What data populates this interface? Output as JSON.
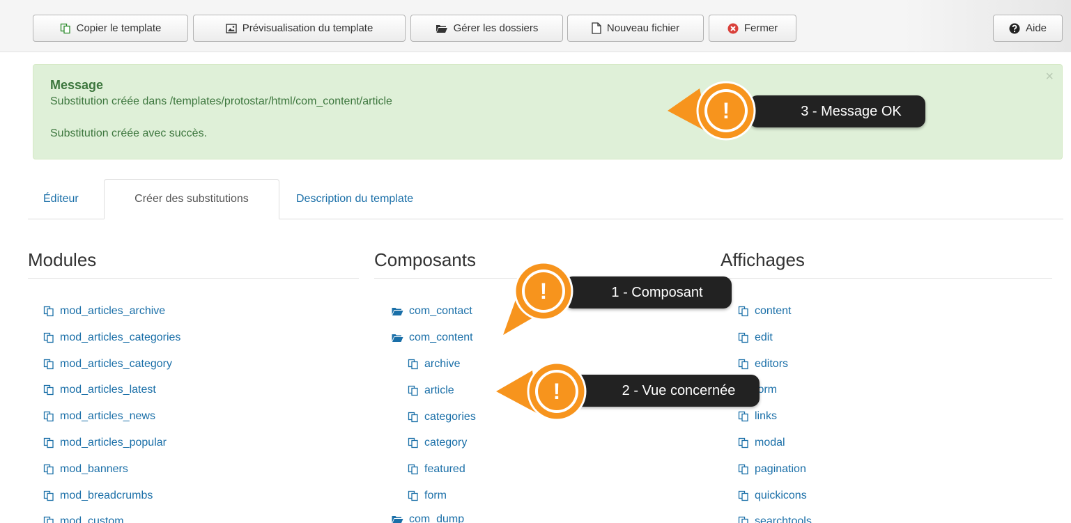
{
  "toolbar": {
    "copy_template": "Copier le template",
    "preview_template": "Prévisualisation du template",
    "manage_folders": "Gérer les dossiers",
    "new_file": "Nouveau fichier",
    "close": "Fermer",
    "help": "Aide"
  },
  "message": {
    "heading": "Message",
    "line1": "Substitution créée dans /templates/protostar/html/com_content/article",
    "line2": "Substitution créée avec succès.",
    "close_symbol": "×"
  },
  "tabs": [
    {
      "label": "Éditeur",
      "active": false
    },
    {
      "label": "Créer des substitutions",
      "active": true
    },
    {
      "label": "Description du template",
      "active": false
    }
  ],
  "columns": {
    "modules": {
      "title": "Modules",
      "items": [
        "mod_articles_archive",
        "mod_articles_categories",
        "mod_articles_category",
        "mod_articles_latest",
        "mod_articles_news",
        "mod_articles_popular",
        "mod_banners",
        "mod_breadcrumbs",
        "mod_custom"
      ]
    },
    "components": {
      "title": "Composants",
      "folder1": "com_contact",
      "folder2": "com_content",
      "subitems": [
        "archive",
        "article",
        "categories",
        "category",
        "featured",
        "form"
      ],
      "folder3": "com_dump"
    },
    "layouts": {
      "title": "Affichages",
      "items": [
        "content",
        "edit",
        "editors",
        "form",
        "links",
        "modal",
        "pagination",
        "quickicons",
        "searchtools"
      ]
    }
  },
  "callouts": {
    "c1": "1 - Composant",
    "c2": "2 - Vue concernée",
    "c3": "3 - Message OK",
    "exclamation": "!"
  },
  "icons": {
    "copy": "copy-icon",
    "image": "image-icon",
    "folder": "folder-icon",
    "file": "file-icon",
    "close": "close-circle-icon",
    "help": "question-circle-icon",
    "exclamation": "exclamation-pin-icon"
  },
  "colors": {
    "link": "#1a6fa8",
    "success_bg": "#dff0d8",
    "success_text": "#3c763d",
    "callout_orange": "#f7941d",
    "callout_dark": "#222222",
    "close_red": "#d9403a"
  }
}
